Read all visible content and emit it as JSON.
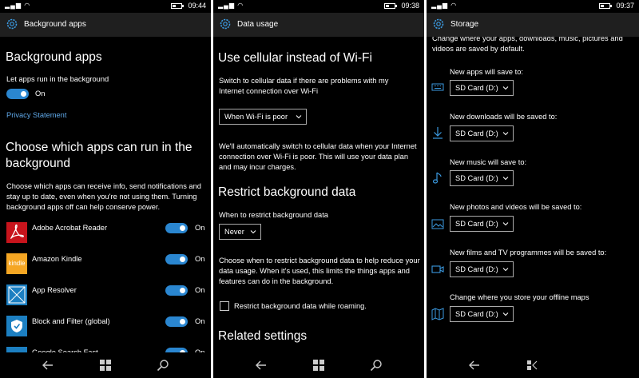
{
  "panel1": {
    "status": {
      "time": "09:44"
    },
    "header": {
      "title": "Background apps"
    },
    "title": "Background apps",
    "let_apps_label": "Let apps run in the background",
    "toggle_on": "On",
    "privacy_link": "Privacy Statement",
    "choose_title": "Choose which apps can run in the background",
    "choose_desc": "Choose which apps can receive info, send notifications and stay up to date, even when you're not using them. Turning background apps off can help conserve power.",
    "apps": [
      {
        "name": "Adobe Acrobat Reader",
        "state": "On",
        "icon": "acrobat-icon",
        "color": "#c8141c"
      },
      {
        "name": "Amazon Kindle",
        "state": "On",
        "icon": "kindle-icon",
        "color": "#f5a623",
        "icon_text": "kindle"
      },
      {
        "name": "App Resolver",
        "state": "On",
        "icon": "app-resolver-icon",
        "color": "#1c7fc1"
      },
      {
        "name": "Block and Filter (global)",
        "state": "On",
        "icon": "shield-icon",
        "color": "#1c7fc1"
      },
      {
        "name": "Google Search Fast",
        "state": "On",
        "icon": "google-icon",
        "color": "#1c7fc1"
      }
    ]
  },
  "panel2": {
    "status": {
      "time": "09:38"
    },
    "header": {
      "title": "Data usage"
    },
    "cellular_title": "Use cellular instead of Wi-Fi",
    "cellular_desc": "Switch to cellular data if there are problems with my Internet connection over Wi-Fi",
    "cellular_select": "When Wi-Fi is poor",
    "cellular_note": "We'll automatically switch to cellular data when your Internet connection over Wi-Fi is poor. This will use your data plan and may incur charges.",
    "restrict_title": "Restrict background data",
    "restrict_label": "When to restrict background data",
    "restrict_select": "Never",
    "restrict_desc": "Choose when to restrict background data to help reduce your data usage. When it's used, this limits the things apps and features can do in the background.",
    "roaming_checkbox": "Restrict background data while roaming.",
    "related_title": "Related settings"
  },
  "panel3": {
    "status": {
      "time": "09:37"
    },
    "header": {
      "title": "Storage"
    },
    "intro": "Change where your apps, downloads, music, pictures and videos are saved by default.",
    "rows": [
      {
        "label": "New apps will save to:",
        "value": "SD Card (D:)",
        "icon": "keyboard-icon"
      },
      {
        "label": "New downloads will be saved to:",
        "value": "SD Card (D:)",
        "icon": "download-icon"
      },
      {
        "label": "New music will save to:",
        "value": "SD Card (D:)",
        "icon": "music-icon"
      },
      {
        "label": "New photos and videos will be saved to:",
        "value": "SD Card (D:)",
        "icon": "photo-icon"
      },
      {
        "label": "New films and TV programmes will be saved to:",
        "value": "SD Card (D:)",
        "icon": "video-icon"
      },
      {
        "label": "Change where you store your offline maps",
        "value": "SD Card (D:)",
        "icon": "map-icon"
      }
    ]
  },
  "colors": {
    "accent": "#2a86d0",
    "link": "#5fa8e8",
    "header_bg": "#1f1f1f"
  }
}
